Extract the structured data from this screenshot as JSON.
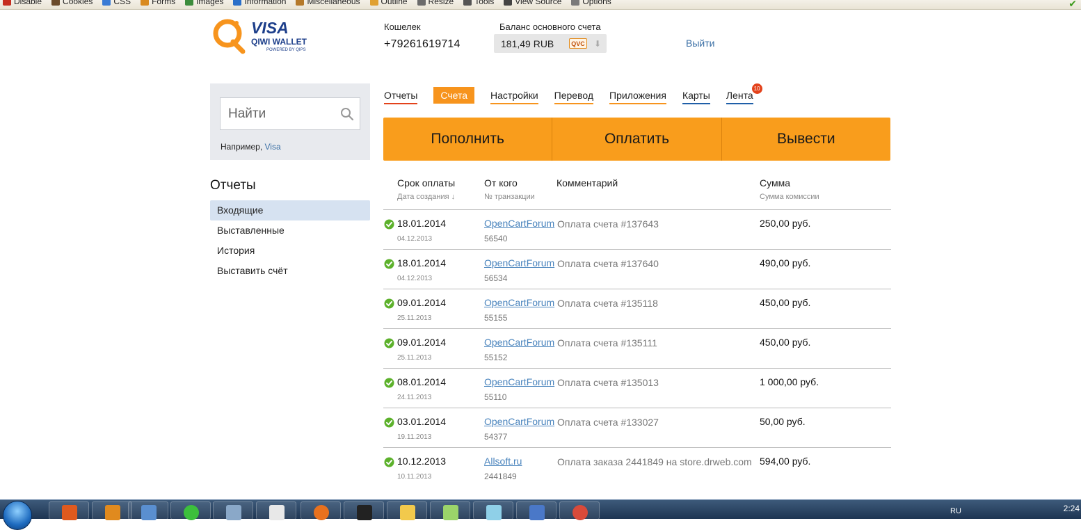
{
  "devbar": {
    "items": [
      "Disable",
      "Cookies",
      "CSS",
      "Forms",
      "Images",
      "Information",
      "Miscellaneous",
      "Outline",
      "Resize",
      "Tools",
      "View Source",
      "Options"
    ]
  },
  "header": {
    "wallet_label": "Кошелек",
    "wallet_number": "+79261619714",
    "balance_label": "Баланс основного счета",
    "balance_value": "181,49 RUB",
    "currency_badge": "QVC",
    "logout": "Выйти"
  },
  "search": {
    "placeholder": "Найти",
    "example_prefix": "Например, ",
    "example_link": "Visa"
  },
  "sidebar": {
    "title": "Отчеты",
    "items": [
      {
        "label": "Входящие",
        "active": true
      },
      {
        "label": "Выставленные"
      },
      {
        "label": "История"
      },
      {
        "label": "Выставить счёт"
      }
    ]
  },
  "tabs": [
    {
      "label": "Отчеты",
      "color": "#e3421b"
    },
    {
      "label": "Счета",
      "active": true
    },
    {
      "label": "Настройки",
      "color": "#f7941d"
    },
    {
      "label": "Перевод",
      "color": "#f7941d"
    },
    {
      "label": "Приложения",
      "color": "#f7941d"
    },
    {
      "label": "Карты",
      "color": "#1f5fa8"
    },
    {
      "label": "Лента",
      "color": "#1f5fa8",
      "badge": "10"
    }
  ],
  "actions": [
    "Пополнить",
    "Оплатить",
    "Вывести"
  ],
  "table": {
    "headers": {
      "due": "Срок оплаты",
      "created": "Дата создания ↓",
      "from": "От кого",
      "txn": "№ транзакции",
      "comment": "Комментарий",
      "sum": "Сумма",
      "fee": "Сумма комиссии"
    },
    "rows": [
      {
        "due": "18.01.2014",
        "created": "04.12.2013",
        "from": "OpenCartForum",
        "txn": "56540",
        "comment": "Оплата счета #137643",
        "sum": "250,00 руб."
      },
      {
        "due": "18.01.2014",
        "created": "04.12.2013",
        "from": "OpenCartForum",
        "txn": "56534",
        "comment": "Оплата счета #137640",
        "sum": "490,00 руб."
      },
      {
        "due": "09.01.2014",
        "created": "25.11.2013",
        "from": "OpenCartForum",
        "txn": "55155",
        "comment": "Оплата счета #135118",
        "sum": "450,00 руб."
      },
      {
        "due": "09.01.2014",
        "created": "25.11.2013",
        "from": "OpenCartForum",
        "txn": "55152",
        "comment": "Оплата счета #135111",
        "sum": "450,00 руб."
      },
      {
        "due": "08.01.2014",
        "created": "24.11.2013",
        "from": "OpenCartForum",
        "txn": "55110",
        "comment": "Оплата счета #135013",
        "sum": "1 000,00 руб."
      },
      {
        "due": "03.01.2014",
        "created": "19.11.2013",
        "from": "OpenCartForum",
        "txn": "54377",
        "comment": "Оплата счета #133027",
        "sum": "50,00 руб."
      },
      {
        "due": "10.12.2013",
        "created": "10.11.2013",
        "from": "Allsoft.ru",
        "txn": "2441849",
        "comment": "Оплата заказа 2441849 на store.drweb.com",
        "sum": "594,00 руб."
      }
    ]
  },
  "taskbar": {
    "lang": "RU",
    "clock": "2:24"
  },
  "colors": {
    "accent": "#f99d1c",
    "link": "#4a84bd"
  },
  "logo": {
    "line1": "VISA",
    "line2": "QIWI WALLET",
    "line3": "POWERED BY QIPS"
  }
}
